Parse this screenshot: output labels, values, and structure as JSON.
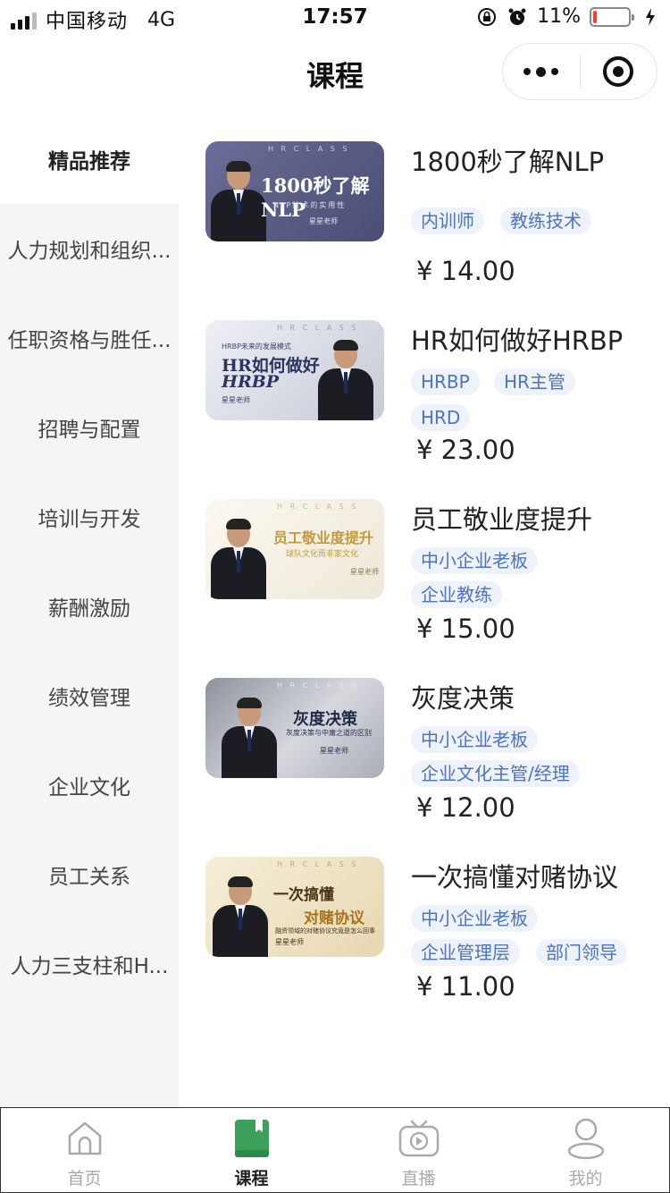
{
  "status_bar": {
    "carrier": "中国移动",
    "network": "4G",
    "time": "17:57",
    "battery_percent": "11%",
    "battery_level": 0.11,
    "battery_color": "#ff3b30"
  },
  "nav": {
    "title": "课程"
  },
  "sidebar": {
    "items": [
      {
        "label": "精品推荐",
        "active": true
      },
      {
        "label": "人力规划和组织..."
      },
      {
        "label": "任职资格与胜任..."
      },
      {
        "label": "招聘与配置"
      },
      {
        "label": "培训与开发"
      },
      {
        "label": "薪酬激励"
      },
      {
        "label": "绩效管理"
      },
      {
        "label": "企业文化"
      },
      {
        "label": "员工关系"
      },
      {
        "label": "人力三支柱和H..."
      }
    ]
  },
  "courses": [
    {
      "title": "1800秒了解NLP",
      "tags": [
        "内训师",
        "教练技术"
      ],
      "price": "¥ 14.00",
      "thumb": {
        "headline": "1800秒了解NLP",
        "sub": "NLP技术的实用性",
        "teacher": "星星老师",
        "top": "H R C L A S S",
        "bg": "#5a5e86"
      }
    },
    {
      "title": "HR如何做好HRBP",
      "tags": [
        "HRBP",
        "HR主管",
        "HRD"
      ],
      "price": "¥ 23.00",
      "thumb": {
        "headline": "HR如何做好",
        "headline2": "HRBP",
        "sub": "HRBP未来的发展模式",
        "teacher": "星星老师",
        "top": "H R C L A S S",
        "bg": "#d9dde6"
      }
    },
    {
      "title": "员工敬业度提升",
      "tags": [
        "中小企业老板",
        "企业教练"
      ],
      "price": "¥ 15.00",
      "thumb": {
        "headline": "员工敬业度提升",
        "sub": "球队文化而非家文化",
        "teacher": "星星老师",
        "top": "H R C L A S S",
        "bg": "#f7f3ea"
      }
    },
    {
      "title": "灰度决策",
      "tags": [
        "中小企业老板",
        "企业文化主管/经理"
      ],
      "price": "¥ 12.00",
      "thumb": {
        "headline": "灰度决策",
        "sub": "灰度决策与中庸之道的区别",
        "teacher": "星星老师",
        "top": "H R C L A S S",
        "bg": "#c9ccd3"
      }
    },
    {
      "title": "一次搞懂对赌协议",
      "tags": [
        "中小企业老板",
        "企业管理层",
        "部门领导"
      ],
      "price": "¥ 11.00",
      "thumb": {
        "headline": "一次搞懂",
        "headline2": "对赌协议",
        "sub": "融资领域的对赌协议究竟是怎么回事",
        "teacher": "星星老师",
        "top": "H R C L A S S",
        "bg": "#efe4c8"
      }
    }
  ],
  "tabbar": {
    "items": [
      {
        "label": "首页",
        "icon": "home-icon"
      },
      {
        "label": "课程",
        "icon": "book-icon",
        "active": true,
        "color": "#3aa05a"
      },
      {
        "label": "直播",
        "icon": "tv-icon"
      },
      {
        "label": "我的",
        "icon": "user-icon"
      }
    ]
  }
}
